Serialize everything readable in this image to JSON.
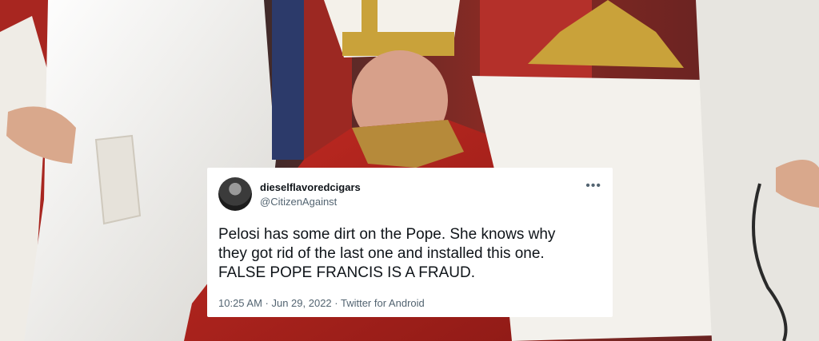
{
  "tweet": {
    "display_name": "dieselflavoredcigars",
    "handle": "@CitizenAgainst",
    "more_icon": "more-horizontal-icon",
    "text_line1": "Pelosi has some dirt on the Pope. She knows why",
    "text_line2": "they got rid of the last one and installed this one.",
    "text_line3": "FALSE POPE FRANCIS IS A FRAUD.",
    "meta": "10:25 AM · Jun 29, 2022 · Twitter for Android"
  },
  "colors": {
    "card_bg": "#ffffff",
    "text": "#0f1419",
    "muted": "#536471",
    "red_vestment": "#b3241f",
    "white_vestment": "#f2f1ee",
    "gold": "#c9a23a"
  }
}
